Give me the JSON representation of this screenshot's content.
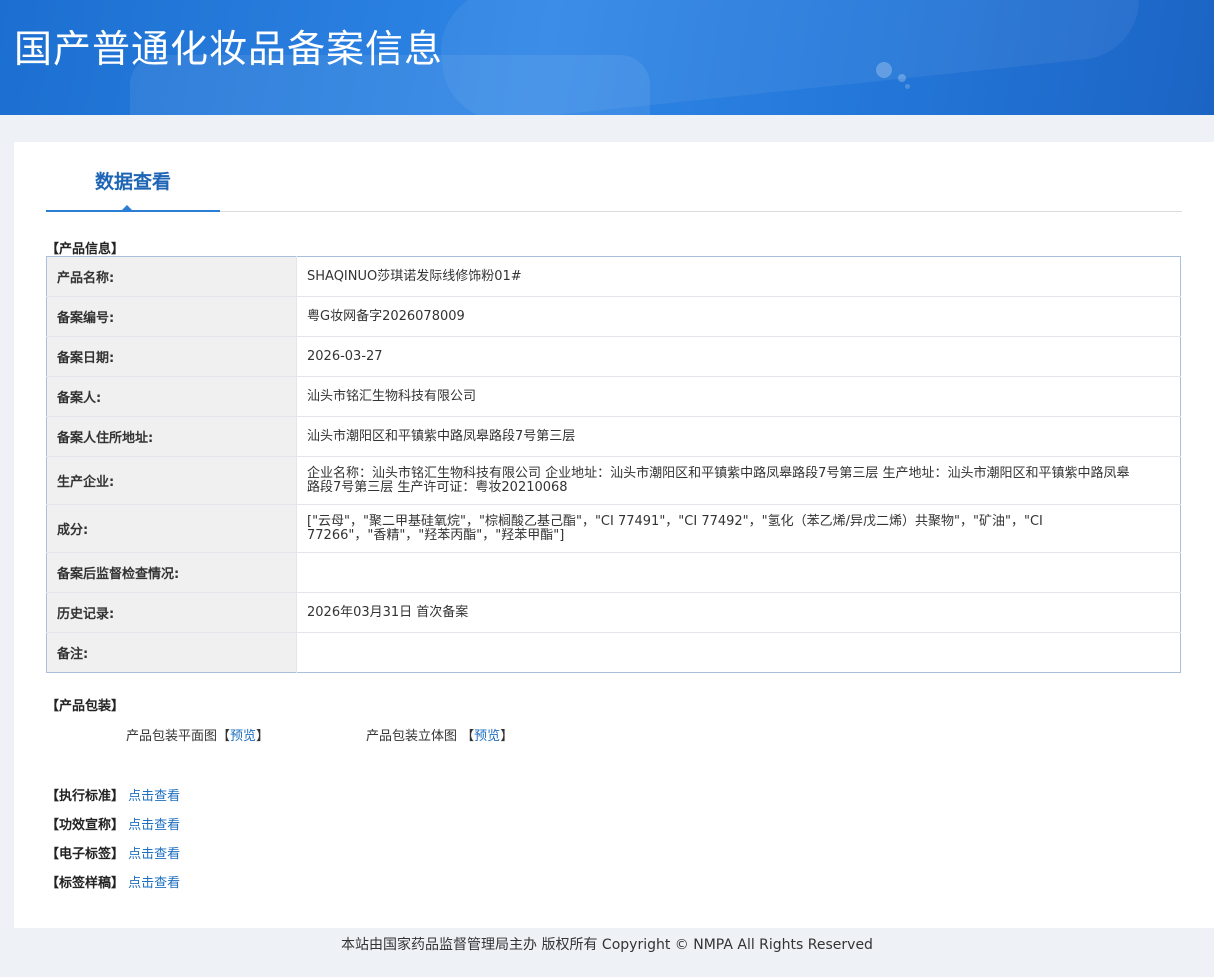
{
  "header": {
    "title": "国产普通化妆品备案信息"
  },
  "tabs": [
    {
      "label": "数据查看"
    }
  ],
  "product_info": {
    "section_label": "【产品信息】",
    "rows": [
      {
        "key": "产品名称:",
        "value": "SHAQINUO莎琪诺发际线修饰粉01#"
      },
      {
        "key": "备案编号:",
        "value": "粤G妆网备字2026078009"
      },
      {
        "key": "备案日期:",
        "value": "2026-03-27"
      },
      {
        "key": "备案人:",
        "value": "汕头市铭汇生物科技有限公司"
      },
      {
        "key": "备案人住所地址:",
        "value": "汕头市潮阳区和平镇紫中路凤皋路段7号第三层"
      },
      {
        "key": "生产企业:",
        "value": "企业名称：汕头市铭汇生物科技有限公司 企业地址：汕头市潮阳区和平镇紫中路凤皋路段7号第三层 生产地址：汕头市潮阳区和平镇紫中路凤皋路段7号第三层 生产许可证：粤妆20210068"
      },
      {
        "key": "成分:",
        "value": "[\"云母\"，\"聚二甲基硅氧烷\"，\"棕榈酸乙基己酯\"，\"CI 77491\"，\"CI 77492\"，\"氢化（苯乙烯/异戊二烯）共聚物\"，\"矿油\"，\"CI 77266\"，\"香精\"，\"羟苯丙酯\"，\"羟苯甲酯\"]"
      },
      {
        "key": "备案后监督检查情况:",
        "value": ""
      },
      {
        "key": "历史记录:",
        "value": "2026年03月31日 首次备案"
      },
      {
        "key": "备注:",
        "value": ""
      }
    ]
  },
  "packaging": {
    "section_label": "【产品包装】",
    "flat_label": "产品包装平面图",
    "solid_label": "产品包装立体图",
    "bracket_open": "【",
    "bracket_close": "】",
    "preview_link": "预览"
  },
  "links": [
    {
      "label": "【执行标准】",
      "link": "点击查看"
    },
    {
      "label": "【功效宣称】",
      "link": "点击查看"
    },
    {
      "label": "【电子标签】",
      "link": "点击查看"
    },
    {
      "label": "【标签样稿】",
      "link": "点击查看"
    }
  ],
  "footer": {
    "text": "本站由国家药品监督管理局主办 版权所有 Copyright © NMPA All Rights Reserved"
  }
}
